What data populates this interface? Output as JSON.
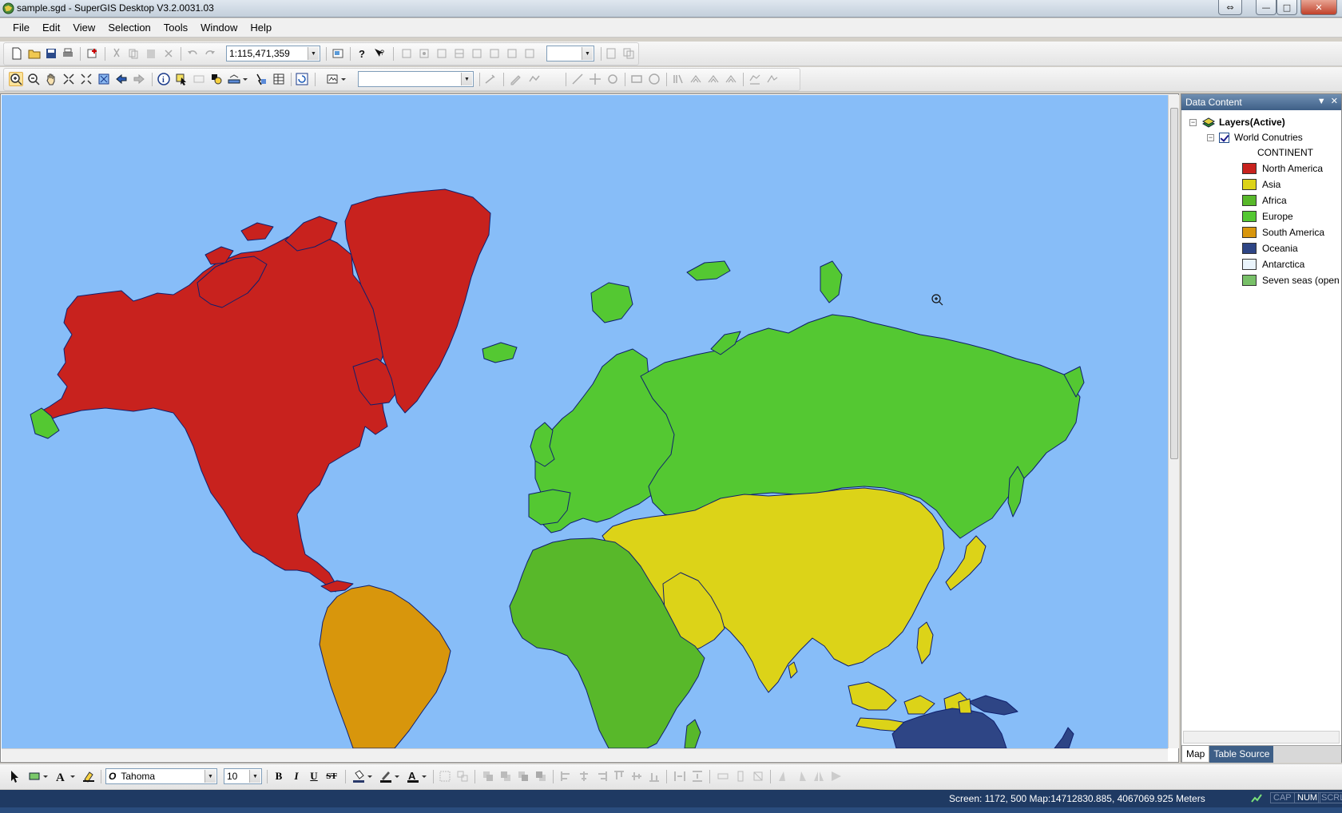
{
  "window": {
    "title": "sample.sgd - SuperGIS Desktop V3.2.0031.03"
  },
  "menu": [
    "File",
    "Edit",
    "View",
    "Selection",
    "Tools",
    "Window",
    "Help"
  ],
  "toolbar": {
    "scale_value": "1:115,471,359",
    "font_name": "Tahoma",
    "font_size": "10",
    "bold_label": "B",
    "italic_label": "I",
    "underline_label": "U",
    "strike_label": "ST"
  },
  "data_content": {
    "title": "Data Content",
    "root_label": "Layers(Active)",
    "layer_label": "World Conutries",
    "field_label": "CONTINENT",
    "legend": [
      {
        "label": "North America",
        "color": "#c8221e"
      },
      {
        "label": "Asia",
        "color": "#dcd318"
      },
      {
        "label": "Africa",
        "color": "#58b82a"
      },
      {
        "label": "Europe",
        "color": "#54c832"
      },
      {
        "label": "South America",
        "color": "#d8960c"
      },
      {
        "label": "Oceania",
        "color": "#2e4585"
      },
      {
        "label": "Antarctica",
        "color": "#eaf4fb"
      },
      {
        "label": "Seven seas (open ocean)",
        "color": "#78c068"
      }
    ],
    "tabs": [
      "Map",
      "Table Source"
    ]
  },
  "map": {
    "ocean_color": "#87bdf8",
    "outline_color": "#0f1f6e"
  },
  "status": {
    "coords": "Screen: 1172, 500  Map:14712830.885, 4067069.925 Meters",
    "indicators": [
      "CAP",
      "NUM",
      "SCRL"
    ]
  }
}
